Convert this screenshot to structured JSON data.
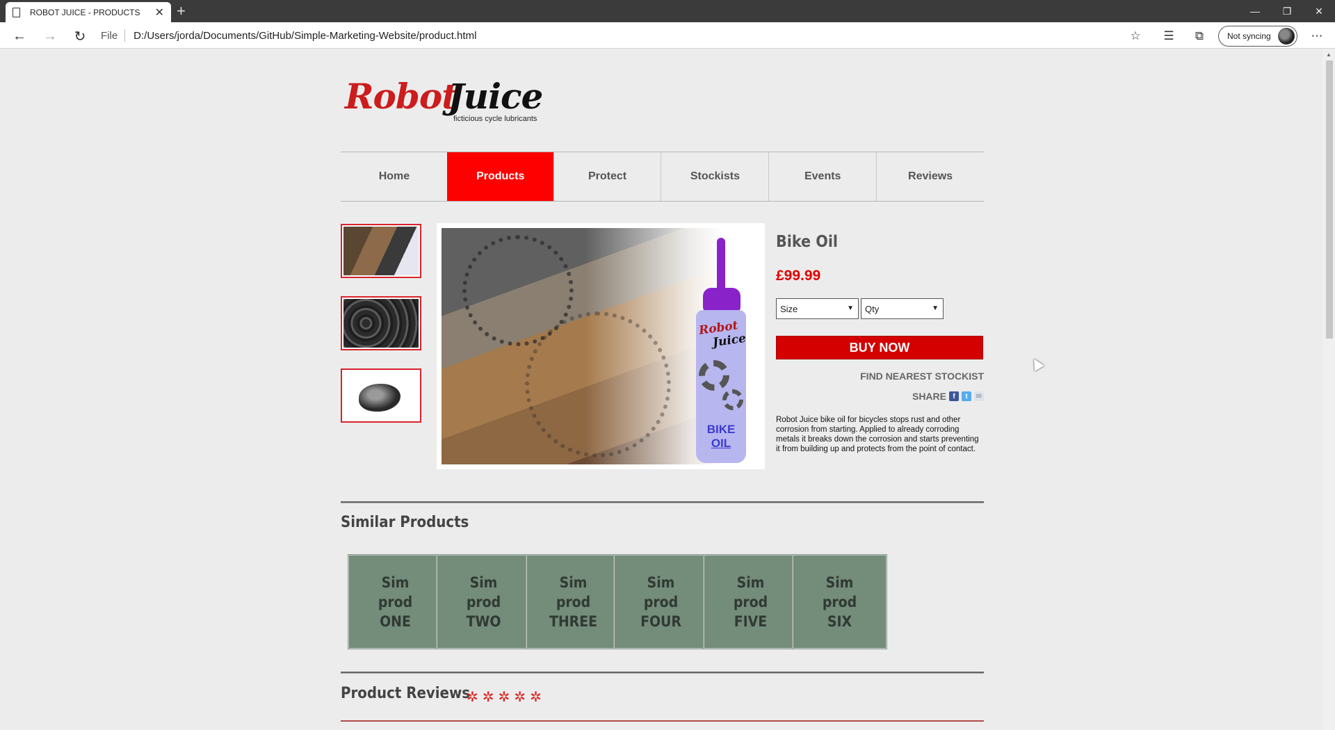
{
  "browser": {
    "tab_title": "ROBOT JUICE - PRODUCTS",
    "url_scheme": "File",
    "url": "D:/Users/jorda/Documents/GitHub/Simple-Marketing-Website/product.html",
    "sync_label": "Not syncing"
  },
  "site": {
    "logo_robot": "Robot",
    "logo_juice": "Juice",
    "tagline": "ficticious cycle lubricants"
  },
  "nav": {
    "items": [
      {
        "label": "Home",
        "active": false
      },
      {
        "label": "Products",
        "active": true
      },
      {
        "label": "Protect",
        "active": false
      },
      {
        "label": "Stockists",
        "active": false
      },
      {
        "label": "Events",
        "active": false
      },
      {
        "label": "Reviews",
        "active": false
      }
    ]
  },
  "product": {
    "name": "Bike Oil",
    "price": "£99.99",
    "size_select": "Size",
    "qty_select": "Qty",
    "buy_label": "BUY NOW",
    "find_stockist": "FIND NEAREST STOCKIST",
    "share_label": "SHARE",
    "description": "Robot Juice bike oil for bicycles stops rust and other corrosion from starting. Applied to already corroding metals it breaks down the corrosion and starts preventing it from building up and protects from the point of contact.",
    "bottle_brand_1": "Robot",
    "bottle_brand_2": "Juice",
    "bottle_text_1": "BIKE",
    "bottle_text_2": "OIL"
  },
  "similar": {
    "title": "Similar Products",
    "items": [
      {
        "line1": "Sim",
        "line2": "prod",
        "line3": "ONE"
      },
      {
        "line1": "Sim",
        "line2": "prod",
        "line3": "TWO"
      },
      {
        "line1": "Sim",
        "line2": "prod",
        "line3": "THREE"
      },
      {
        "line1": "Sim",
        "line2": "prod",
        "line3": "FOUR"
      },
      {
        "line1": "Sim",
        "line2": "prod",
        "line3": "FIVE"
      },
      {
        "line1": "Sim",
        "line2": "prod",
        "line3": "SIX"
      }
    ]
  },
  "reviews": {
    "title": "Product Reviews",
    "rating": 5,
    "star_glyph": "✲"
  },
  "colors": {
    "accent_red": "#ff0000",
    "buy_red": "#d40000",
    "sim_tile": "#748c7a"
  }
}
